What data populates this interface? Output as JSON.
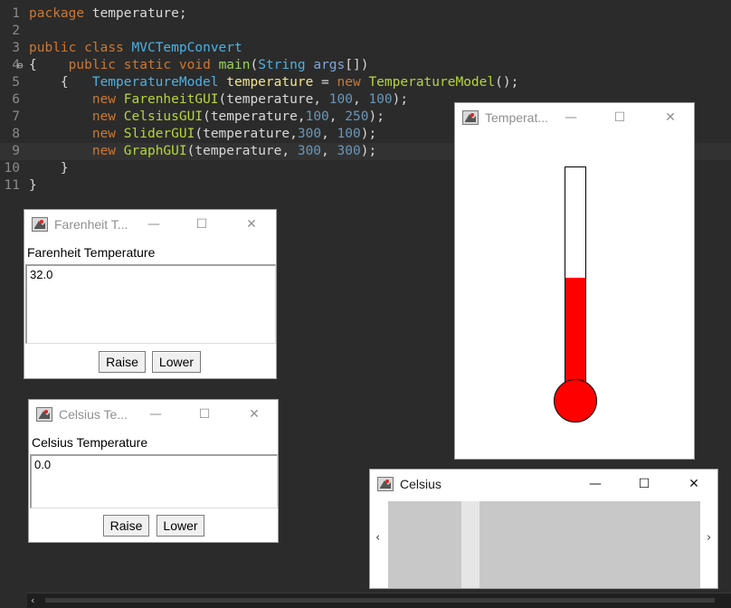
{
  "editor": {
    "lines": [
      {
        "n": "1",
        "tokens": [
          {
            "t": "package",
            "c": "kw"
          },
          {
            "t": " temperature;",
            "c": "pl"
          }
        ]
      },
      {
        "n": "2",
        "tokens": []
      },
      {
        "n": "3",
        "tokens": [
          {
            "t": "public",
            "c": "kw"
          },
          {
            "t": " ",
            "c": "pl"
          },
          {
            "t": "class",
            "c": "kw"
          },
          {
            "t": " ",
            "c": "pl"
          },
          {
            "t": "MVCTempConvert",
            "c": "cls"
          }
        ]
      },
      {
        "n": "4",
        "fold": "⊖",
        "tokens": [
          {
            "t": "{",
            "c": "pl"
          },
          {
            "t": "    ",
            "c": "pl"
          },
          {
            "t": "public",
            "c": "kw"
          },
          {
            "t": " ",
            "c": "pl"
          },
          {
            "t": "static",
            "c": "kw"
          },
          {
            "t": " ",
            "c": "pl"
          },
          {
            "t": "void",
            "c": "kw"
          },
          {
            "t": " ",
            "c": "pl"
          },
          {
            "t": "main",
            "c": "mth"
          },
          {
            "t": "(",
            "c": "pl"
          },
          {
            "t": "String",
            "c": "cls"
          },
          {
            "t": " ",
            "c": "pl"
          },
          {
            "t": "args",
            "c": "par"
          },
          {
            "t": "[])",
            "c": "pl"
          }
        ]
      },
      {
        "n": "5",
        "tokens": [
          {
            "t": "    {   ",
            "c": "pl"
          },
          {
            "t": "TemperatureModel",
            "c": "cls"
          },
          {
            "t": " ",
            "c": "pl"
          },
          {
            "t": "temperature",
            "c": "var"
          },
          {
            "t": " = ",
            "c": "pl"
          },
          {
            "t": "new",
            "c": "kw"
          },
          {
            "t": " ",
            "c": "pl"
          },
          {
            "t": "TemperatureModel",
            "c": "typ"
          },
          {
            "t": "();",
            "c": "pl"
          }
        ]
      },
      {
        "n": "6",
        "tokens": [
          {
            "t": "        ",
            "c": "pl"
          },
          {
            "t": "new",
            "c": "kw"
          },
          {
            "t": " ",
            "c": "pl"
          },
          {
            "t": "FarenheitGUI",
            "c": "typ"
          },
          {
            "t": "(temperature, ",
            "c": "pl"
          },
          {
            "t": "100",
            "c": "num"
          },
          {
            "t": ", ",
            "c": "pl"
          },
          {
            "t": "100",
            "c": "num"
          },
          {
            "t": ");",
            "c": "pl"
          }
        ]
      },
      {
        "n": "7",
        "tokens": [
          {
            "t": "        ",
            "c": "pl"
          },
          {
            "t": "new",
            "c": "kw"
          },
          {
            "t": " ",
            "c": "pl"
          },
          {
            "t": "CelsiusGUI",
            "c": "typ"
          },
          {
            "t": "(temperature,",
            "c": "pl"
          },
          {
            "t": "100",
            "c": "num"
          },
          {
            "t": ", ",
            "c": "pl"
          },
          {
            "t": "250",
            "c": "num"
          },
          {
            "t": ");",
            "c": "pl"
          }
        ]
      },
      {
        "n": "8",
        "tokens": [
          {
            "t": "        ",
            "c": "pl"
          },
          {
            "t": "new",
            "c": "kw"
          },
          {
            "t": " ",
            "c": "pl"
          },
          {
            "t": "SliderGUI",
            "c": "typ"
          },
          {
            "t": "(temperature,",
            "c": "pl"
          },
          {
            "t": "300",
            "c": "num"
          },
          {
            "t": ", ",
            "c": "pl"
          },
          {
            "t": "100",
            "c": "num"
          },
          {
            "t": ");",
            "c": "pl"
          }
        ]
      },
      {
        "n": "9",
        "current": true,
        "tokens": [
          {
            "t": "        ",
            "c": "pl"
          },
          {
            "t": "new",
            "c": "kw"
          },
          {
            "t": " ",
            "c": "pl"
          },
          {
            "t": "GraphGUI",
            "c": "typ"
          },
          {
            "t": "(temperature, ",
            "c": "pl"
          },
          {
            "t": "300",
            "c": "num"
          },
          {
            "t": ", ",
            "c": "pl"
          },
          {
            "t": "300",
            "c": "num"
          },
          {
            "t": ");",
            "c": "pl"
          }
        ]
      },
      {
        "n": "10",
        "tokens": [
          {
            "t": "    }",
            "c": "pl"
          }
        ]
      },
      {
        "n": "11",
        "tokens": [
          {
            "t": "}",
            "c": "pl"
          }
        ]
      }
    ],
    "hscroll_left_glyph": "‹"
  },
  "farenheit_window": {
    "title": "Farenheit T...",
    "min_glyph": "—",
    "max_glyph": "☐",
    "close_glyph": "✕",
    "label": "Farenheit Temperature",
    "value": "32.0",
    "raise_label": "Raise",
    "lower_label": "Lower"
  },
  "celsius_window": {
    "title": "Celsius Te...",
    "min_glyph": "—",
    "max_glyph": "☐",
    "close_glyph": "✕",
    "label": "Celsius Temperature",
    "value": "0.0",
    "raise_label": "Raise",
    "lower_label": "Lower"
  },
  "graph_window": {
    "title": "Temperat...",
    "min_glyph": "—",
    "max_glyph": "☐",
    "close_glyph": "✕",
    "fill_fraction": 0.53,
    "fill_color": "#ff0000"
  },
  "slider_window": {
    "title": "Celsius",
    "min_glyph": "—",
    "max_glyph": "☐",
    "close_glyph": "✕",
    "left_arrow": "‹",
    "right_arrow": "›",
    "thumb_fraction": 0.25
  }
}
